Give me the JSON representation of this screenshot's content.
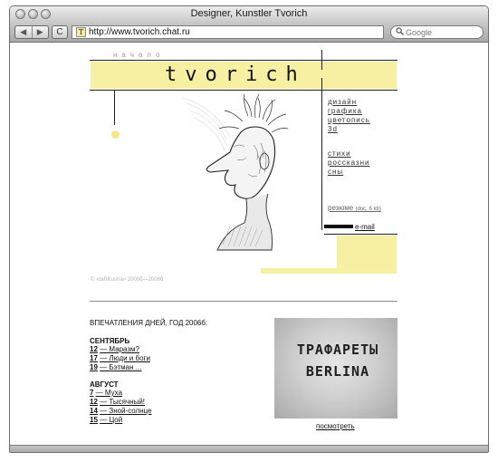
{
  "window": {
    "title": "Designer, Kunstler Tvorich"
  },
  "toolbar": {
    "url": "http://www.tvorich.chat.ru",
    "search_placeholder": "Google",
    "back_glyph": "◀",
    "forward_glyph": "▶",
    "reload_glyph": "C",
    "favicon_glyph": "T"
  },
  "header": {
    "nav_hint": "начало",
    "logo": "tvorich"
  },
  "menu": {
    "art": [
      "дизайн",
      "графика",
      "цветопись",
      "3d"
    ],
    "writing": [
      "стихи",
      "россказни",
      "сны"
    ]
  },
  "resume": {
    "label": "резюме",
    "meta": "(doc, 6 kb)"
  },
  "email": {
    "label": "e-mail"
  },
  "footer": {
    "copyright": "© «taRKusha» 2000б—2006б"
  },
  "news": {
    "title": "ВПЕЧАТЛЕНИЯ ДНЕЙ, ГОД 2006б:",
    "months": [
      {
        "name": "СЕНТЯБРЬ",
        "items": [
          {
            "day": "12",
            "text": "— Маразм?"
          },
          {
            "day": "17",
            "text": "— Люди и боги"
          },
          {
            "day": "19",
            "text": "— Бэтман ..."
          }
        ]
      },
      {
        "name": "АВГУСТ",
        "items": [
          {
            "day": "7",
            "text": "— Муха"
          },
          {
            "day": "12",
            "text": "— Тысячный!"
          },
          {
            "day": "14",
            "text": "— Зной-солнце"
          },
          {
            "day": "15",
            "text": "— Цой"
          }
        ]
      }
    ]
  },
  "promo": {
    "line1": "ТРАФАРЕТЫ",
    "line2": "BERLINA",
    "link": "посмотреть"
  },
  "colors": {
    "accent_yellow": "#f7f0a3",
    "dot_yellow": "#f4e88b",
    "ink": "#111111"
  },
  "icons": {
    "search": "search-icon",
    "window_buttons": [
      "close-icon",
      "minimize-icon",
      "zoom-icon"
    ]
  }
}
